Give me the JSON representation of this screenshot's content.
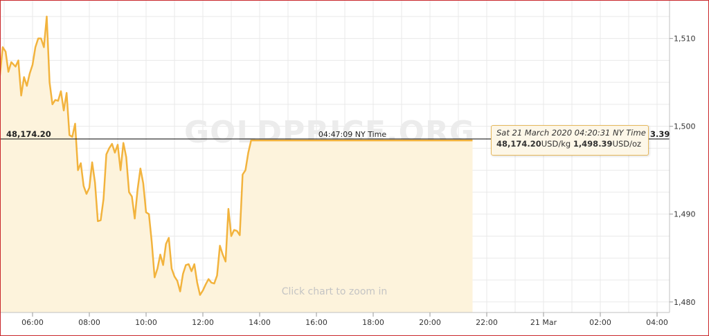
{
  "chart_data": {
    "type": "line",
    "title": "",
    "xlabel": "",
    "ylabel": "",
    "x_ticks": [
      {
        "label": "06:00",
        "t": 1
      },
      {
        "label": "08:00",
        "t": 3
      },
      {
        "label": "10:00",
        "t": 5
      },
      {
        "label": "12:00",
        "t": 7
      },
      {
        "label": "14:00",
        "t": 9
      },
      {
        "label": "16:00",
        "t": 11
      },
      {
        "label": "18:00",
        "t": 13
      },
      {
        "label": "20:00",
        "t": 15
      },
      {
        "label": "22:00",
        "t": 17
      },
      {
        "label": "21 Mar",
        "t": 19
      },
      {
        "label": "02:00",
        "t": 21
      },
      {
        "label": "04:00",
        "t": 23
      }
    ],
    "y_ticks": [
      "1,480",
      "1,490",
      "1,500",
      "1,510"
    ],
    "y_tick_values": [
      1480,
      1490,
      1500,
      1510
    ],
    "ylim": [
      1478.8,
      1514.3
    ],
    "grid": true,
    "series": [
      {
        "color": "#f2b33d",
        "fill": "#fdf3dc",
        "points": [
          [
            -0.25,
            1506.5
          ],
          [
            -0.15,
            1505.8
          ],
          [
            -0.05,
            1509.0
          ],
          [
            0.05,
            1508.5
          ],
          [
            0.15,
            1506.2
          ],
          [
            0.25,
            1507.3
          ],
          [
            0.4,
            1506.8
          ],
          [
            0.5,
            1507.5
          ],
          [
            0.6,
            1503.5
          ],
          [
            0.7,
            1505.6
          ],
          [
            0.8,
            1504.6
          ],
          [
            0.9,
            1506.0
          ],
          [
            1.0,
            1507.0
          ],
          [
            1.1,
            1509.0
          ],
          [
            1.2,
            1510.0
          ],
          [
            1.3,
            1510.0
          ],
          [
            1.4,
            1509.0
          ],
          [
            1.5,
            1512.5
          ],
          [
            1.6,
            1505.0
          ],
          [
            1.7,
            1502.5
          ],
          [
            1.8,
            1503.0
          ],
          [
            1.9,
            1502.9
          ],
          [
            2.0,
            1504.0
          ],
          [
            2.1,
            1501.8
          ],
          [
            2.2,
            1503.8
          ],
          [
            2.3,
            1499.0
          ],
          [
            2.4,
            1498.8
          ],
          [
            2.5,
            1500.3
          ],
          [
            2.6,
            1495.0
          ],
          [
            2.7,
            1495.8
          ],
          [
            2.8,
            1493.2
          ],
          [
            2.9,
            1492.3
          ],
          [
            3.0,
            1493.0
          ],
          [
            3.1,
            1495.9
          ],
          [
            3.2,
            1493.6
          ],
          [
            3.3,
            1489.2
          ],
          [
            3.4,
            1489.3
          ],
          [
            3.5,
            1491.7
          ],
          [
            3.6,
            1496.8
          ],
          [
            3.7,
            1497.5
          ],
          [
            3.8,
            1498.0
          ],
          [
            3.9,
            1497.0
          ],
          [
            4.0,
            1497.9
          ],
          [
            4.1,
            1495.0
          ],
          [
            4.2,
            1498.1
          ],
          [
            4.3,
            1496.5
          ],
          [
            4.4,
            1492.5
          ],
          [
            4.5,
            1492.0
          ],
          [
            4.6,
            1489.5
          ],
          [
            4.7,
            1492.8
          ],
          [
            4.8,
            1495.2
          ],
          [
            4.9,
            1493.5
          ],
          [
            5.0,
            1490.2
          ],
          [
            5.1,
            1490.0
          ],
          [
            5.2,
            1486.8
          ],
          [
            5.3,
            1482.8
          ],
          [
            5.4,
            1483.8
          ],
          [
            5.5,
            1485.4
          ],
          [
            5.6,
            1484.2
          ],
          [
            5.7,
            1486.6
          ],
          [
            5.8,
            1487.3
          ],
          [
            5.9,
            1483.8
          ],
          [
            6.0,
            1482.9
          ],
          [
            6.1,
            1482.4
          ],
          [
            6.2,
            1481.2
          ],
          [
            6.3,
            1483.2
          ],
          [
            6.4,
            1484.2
          ],
          [
            6.5,
            1484.3
          ],
          [
            6.6,
            1483.5
          ],
          [
            6.7,
            1484.3
          ],
          [
            6.8,
            1482.2
          ],
          [
            6.9,
            1480.8
          ],
          [
            7.0,
            1481.3
          ],
          [
            7.1,
            1482.0
          ],
          [
            7.2,
            1482.6
          ],
          [
            7.3,
            1482.2
          ],
          [
            7.4,
            1482.1
          ],
          [
            7.5,
            1483.0
          ],
          [
            7.6,
            1486.4
          ],
          [
            7.7,
            1485.4
          ],
          [
            7.8,
            1484.6
          ],
          [
            7.9,
            1490.6
          ],
          [
            8.0,
            1487.5
          ],
          [
            8.1,
            1488.2
          ],
          [
            8.2,
            1488.1
          ],
          [
            8.3,
            1487.6
          ],
          [
            8.4,
            1494.5
          ],
          [
            8.5,
            1495.0
          ],
          [
            8.6,
            1497.0
          ],
          [
            8.7,
            1498.39
          ],
          [
            9.0,
            1498.39
          ],
          [
            10.0,
            1498.39
          ],
          [
            11.0,
            1498.39
          ],
          [
            12.0,
            1498.39
          ],
          [
            13.0,
            1498.39
          ],
          [
            14.0,
            1498.39
          ],
          [
            15.0,
            1498.39
          ],
          [
            16.0,
            1498.39
          ],
          [
            16.5,
            1498.39
          ]
        ]
      }
    ],
    "crosshair_value": 1498.39
  },
  "labels": {
    "left_price": "48,174.20",
    "cursor_time": "04:47:09 NY Time",
    "right_price_partial": "3.39",
    "watermark": "GOLDPRICE.ORG",
    "zoom_hint": "Click chart to zoom in"
  },
  "tooltip": {
    "datetime": "Sat 21 March 2020 04:20:31 NY Time",
    "kg_value": "48,174.20",
    "kg_unit": "USD/kg",
    "oz_value": "1,498.39",
    "oz_unit": "USD/oz"
  },
  "colors": {
    "line": "#f2b33d",
    "fill": "#fdf3dc",
    "grid": "#e6e6e6",
    "crosshair": "#000000",
    "border": "#c9262a"
  }
}
